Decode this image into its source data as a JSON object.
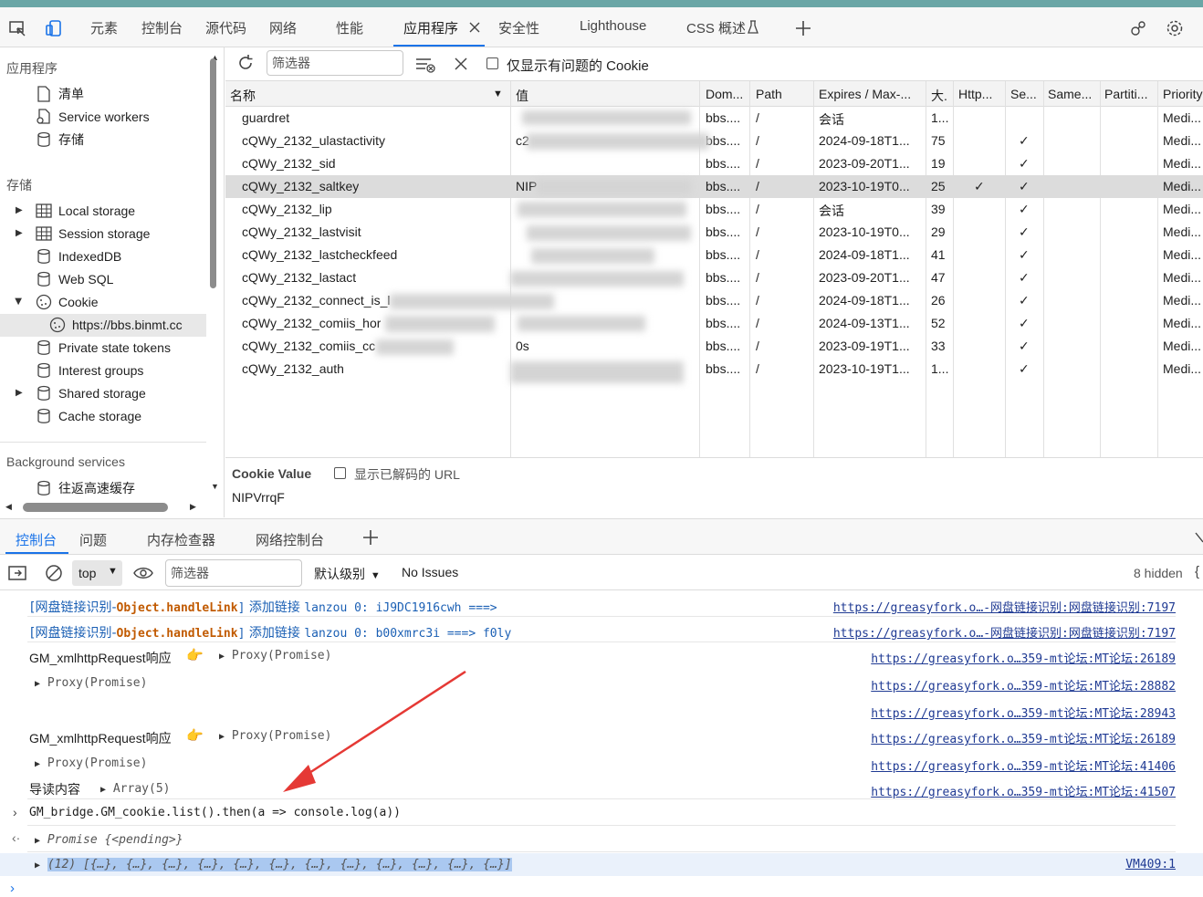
{
  "devtools_tabs": [
    "元素",
    "控制台",
    "源代码",
    "网络",
    "性能",
    "应用程序",
    "安全性",
    "Lighthouse",
    "CSS 概述"
  ],
  "sidebar": {
    "app_section": "应用程序",
    "app_items": [
      "清单",
      "Service workers",
      "存储"
    ],
    "storage_section": "存储",
    "storage_items": [
      "Local storage",
      "Session storage",
      "IndexedDB",
      "Web SQL",
      "Cookie",
      "https://bbs.binmt.cc",
      "Private state tokens",
      "Interest groups",
      "Shared storage",
      "Cache storage"
    ],
    "bg_section": "Background services",
    "bg_items": [
      "往返高速缓存"
    ]
  },
  "cookie_toolbar": {
    "filter_placeholder": "筛选器",
    "only_issues_label": "仅显示有问题的 Cookie"
  },
  "cookie_table": {
    "headers": [
      "名称",
      "值",
      "Dom...",
      "Path",
      "Expires / Max-...",
      "大.",
      "Http...",
      "Se...",
      "Same...",
      "Partiti...",
      "Priority"
    ],
    "rows": [
      {
        "name": "guardret",
        "value": "",
        "domain": "bbs....",
        "path": "/",
        "expires": "会话",
        "size": "1...",
        "http": "",
        "secure": "",
        "priority": "Medi..."
      },
      {
        "name": "cQWy_2132_ulastactivity",
        "value": "c2",
        "domain": "bbs....",
        "path": "/",
        "expires": "2024-09-18T1...",
        "size": "75",
        "http": "",
        "secure": "✓",
        "priority": "Medi..."
      },
      {
        "name": "cQWy_2132_sid",
        "value": "",
        "domain": "bbs....",
        "path": "/",
        "expires": "2023-09-20T1...",
        "size": "19",
        "http": "",
        "secure": "✓",
        "priority": "Medi..."
      },
      {
        "name": "cQWy_2132_saltkey",
        "value": "NIP",
        "domain": "bbs....",
        "path": "/",
        "expires": "2023-10-19T0...",
        "size": "25",
        "http": "✓",
        "secure": "✓",
        "priority": "Medi..."
      },
      {
        "name": "cQWy_2132_lip",
        "value": "",
        "domain": "bbs....",
        "path": "/",
        "expires": "会话",
        "size": "39",
        "http": "",
        "secure": "✓",
        "priority": "Medi..."
      },
      {
        "name": "cQWy_2132_lastvisit",
        "value": "",
        "domain": "bbs....",
        "path": "/",
        "expires": "2023-10-19T0...",
        "size": "29",
        "http": "",
        "secure": "✓",
        "priority": "Medi..."
      },
      {
        "name": "cQWy_2132_lastcheckfeed",
        "value": "",
        "domain": "bbs....",
        "path": "/",
        "expires": "2024-09-18T1...",
        "size": "41",
        "http": "",
        "secure": "✓",
        "priority": "Medi..."
      },
      {
        "name": "cQWy_2132_lastact",
        "value": "",
        "domain": "bbs....",
        "path": "/",
        "expires": "2023-09-20T1...",
        "size": "47",
        "http": "",
        "secure": "✓",
        "priority": "Medi..."
      },
      {
        "name": "cQWy_2132_connect_is_l",
        "value": "",
        "domain": "bbs....",
        "path": "/",
        "expires": "2024-09-18T1...",
        "size": "26",
        "http": "",
        "secure": "✓",
        "priority": "Medi..."
      },
      {
        "name": "cQWy_2132_comiis_hor",
        "value": "",
        "domain": "bbs....",
        "path": "/",
        "expires": "2024-09-13T1...",
        "size": "52",
        "http": "",
        "secure": "✓",
        "priority": "Medi..."
      },
      {
        "name": "cQWy_2132_comiis_cc",
        "value": "0s",
        "domain": "bbs....",
        "path": "/",
        "expires": "2023-09-19T1...",
        "size": "33",
        "http": "",
        "secure": "✓",
        "priority": "Medi..."
      },
      {
        "name": "cQWy_2132_auth",
        "value": "",
        "domain": "bbs....",
        "path": "/",
        "expires": "2023-10-19T1...",
        "size": "1...",
        "http": "",
        "secure": "✓",
        "priority": "Medi..."
      }
    ]
  },
  "cookie_value_pane": {
    "title": "Cookie Value",
    "decode_label": "显示已解码的 URL",
    "value": "NIPVrrqF"
  },
  "drawer_tabs": [
    "控制台",
    "问题",
    "内存检查器",
    "网络控制台"
  ],
  "console_toolbar": {
    "context": "top",
    "filter_placeholder": "筛选器",
    "level": "默认级别",
    "issues": "No Issues",
    "hidden": "8 hidden"
  },
  "console": {
    "line1": {
      "prefix": "[网盘链接识别-",
      "fn": "Object.handleLink",
      "close": "]",
      "text": " 添加链接 ",
      "args": "lanzou 0: iJ9DC1916cwh  ===>",
      "source": "https://greasyfork.o…-网盘链接识别:网盘链接识别:7197"
    },
    "line2": {
      "prefix": "[网盘链接识别-",
      "fn": "Object.handleLink",
      "close": "]",
      "text": " 添加链接 ",
      "args": "lanzou 0: b00xmrc3i  ===> f0ly",
      "source": "https://greasyfork.o…-网盘链接识别:网盘链接识别:7197"
    },
    "line3": {
      "text": "GM_xmlhttpRequest响应",
      "obj": "Proxy(Promise)",
      "source": "https://greasyfork.o…359-mt论坛:MT论坛:26189"
    },
    "line4": {
      "obj": "Proxy(Promise)",
      "source": "https://greasyfork.o…359-mt论坛:MT论坛:28882"
    },
    "line5": {
      "source": "https://greasyfork.o…359-mt论坛:MT论坛:28943"
    },
    "line6": {
      "text": "GM_xmlhttpRequest响应",
      "obj": "Proxy(Promise)",
      "source": "https://greasyfork.o…359-mt论坛:MT论坛:26189"
    },
    "line7": {
      "obj": "Proxy(Promise)",
      "source": "https://greasyfork.o…359-mt论坛:MT论坛:41406"
    },
    "line8": {
      "text": "导读内容",
      "obj": "Array(5)",
      "source": "https://greasyfork.o…359-mt论坛:MT论坛:41507"
    },
    "input": "GM_bridge.GM_cookie.list().then(a => console.log(a))",
    "result": "Promise {<pending>}",
    "array_log": "(12) [{…}, {…}, {…}, {…}, {…}, {…}, {…}, {…}, {…}, {…}, {…}, {…}]",
    "array_source": "VM409:1"
  },
  "colors": {
    "accent": "#1a73e8",
    "arrow": "#e53935",
    "link": "#1f3a93"
  }
}
